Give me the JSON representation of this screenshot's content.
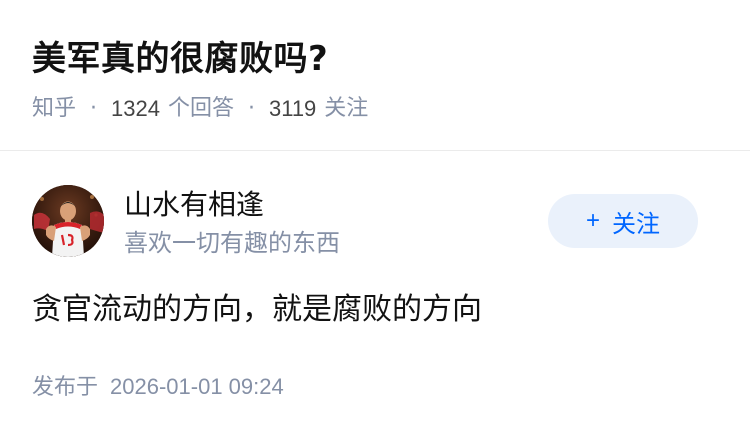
{
  "question": {
    "title": "美军真的很腐败吗?",
    "source": "知乎",
    "separator": "·",
    "answer_count": "1324",
    "answer_label": "个回答",
    "follower_count": "3119",
    "follower_label": "关注"
  },
  "author": {
    "name": "山水有相逢",
    "bio": "喜欢一切有趣的东西",
    "avatar_icon": "avatar-basketball-player",
    "follow_icon": "+",
    "follow_label": "关注"
  },
  "answer": {
    "content": "贪官流动的方向，就是腐败的方向",
    "publish_label": "发布于",
    "publish_time": "2026-01-01 09:24"
  },
  "colors": {
    "title": "#121212",
    "meta": "#8590a6",
    "accent": "#0066ff",
    "button_bg": "#eaf1fb",
    "divider": "#ebebeb"
  }
}
